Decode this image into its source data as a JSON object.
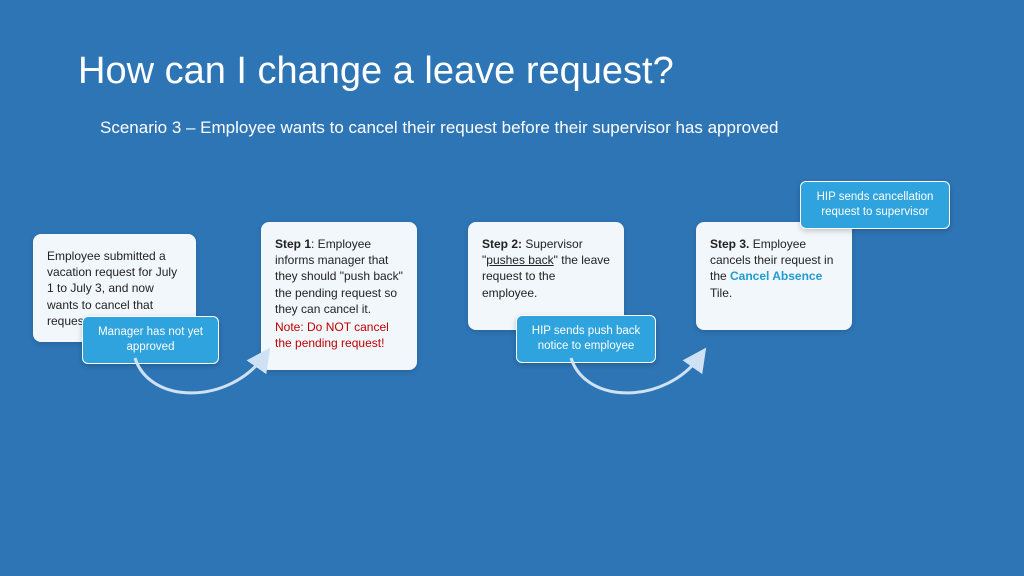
{
  "title": "How can I change a leave request?",
  "subtitle": "Scenario 3 – Employee wants to cancel their request before their supervisor has approved",
  "cards": {
    "c0": {
      "text": "Employee submitted a vacation request for July 1 to July 3, and now wants to cancel that request."
    },
    "c1": {
      "label": "Step 1",
      "text": ": Employee informs manager that they should \"push back\" the pending request so they can cancel it.",
      "note": "Note: Do NOT cancel the pending request!"
    },
    "c2": {
      "label": "Step 2:",
      "pre": " Supervisor \"",
      "uline": "pushes back",
      "post": "\" the leave request to the employee."
    },
    "c3": {
      "label": "Step 3.",
      "pre": " Employee cancels their request in the ",
      "teal": "Cancel Absence",
      "post": " Tile."
    }
  },
  "callouts": {
    "b0": "Manager has not yet approved",
    "b1": "HIP sends push back notice to employee",
    "b2": "HIP sends cancellation request to supervisor"
  }
}
